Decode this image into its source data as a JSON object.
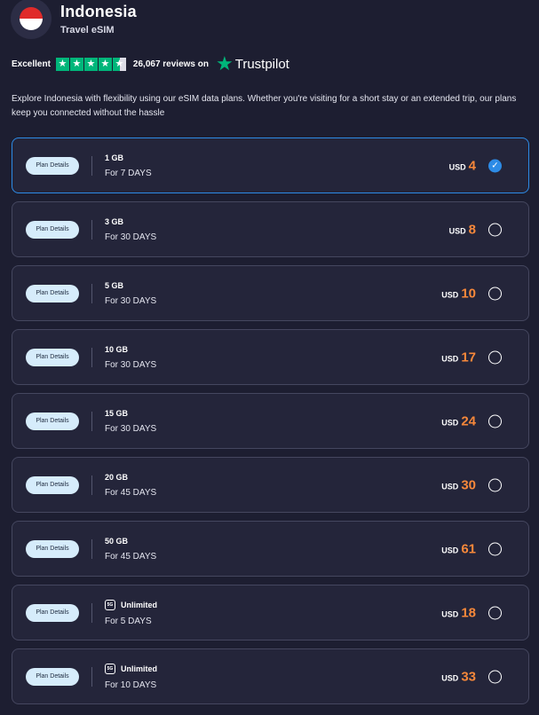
{
  "header": {
    "country": "Indonesia",
    "subtitle": "Travel eSIM"
  },
  "rating": {
    "label": "Excellent",
    "stars": 4.5,
    "reviews_text": "26,067 reviews on",
    "brand": "Trustpilot"
  },
  "description": "Explore Indonesia with flexibility using our eSIM data plans. Whether you're visiting for a short stay or an extended trip, our plans keep you connected without the hassle",
  "plan_details_label": "Plan Details",
  "currency": "USD",
  "plans": [
    {
      "data": "1 GB",
      "duration": "For 7 DAYS",
      "price": "4",
      "selected": true
    },
    {
      "data": "3 GB",
      "duration": "For 30 DAYS",
      "price": "8",
      "selected": false
    },
    {
      "data": "5 GB",
      "duration": "For 30 DAYS",
      "price": "10",
      "selected": false
    },
    {
      "data": "10 GB",
      "duration": "For 30 DAYS",
      "price": "17",
      "selected": false
    },
    {
      "data": "15 GB",
      "duration": "For 30 DAYS",
      "price": "24",
      "selected": false
    },
    {
      "data": "20 GB",
      "duration": "For 45 DAYS",
      "price": "30",
      "selected": false
    },
    {
      "data": "50 GB",
      "duration": "For 45 DAYS",
      "price": "61",
      "selected": false
    },
    {
      "data": "Unlimited",
      "duration": "For 5 DAYS",
      "price": "18",
      "selected": false,
      "badge": "5G"
    },
    {
      "data": "Unlimited",
      "duration": "For 10 DAYS",
      "price": "33",
      "selected": false,
      "badge": "5G"
    }
  ],
  "colors": {
    "background": "#1d1e31",
    "card": "#24253a",
    "accent": "#2d8be6",
    "price": "#f7883a",
    "trustpilot": "#00b67a"
  },
  "icons": {
    "flag": "indonesia-flag-icon",
    "star": "trustpilot-star-icon",
    "check": "check-icon",
    "network": "5g-icon"
  }
}
